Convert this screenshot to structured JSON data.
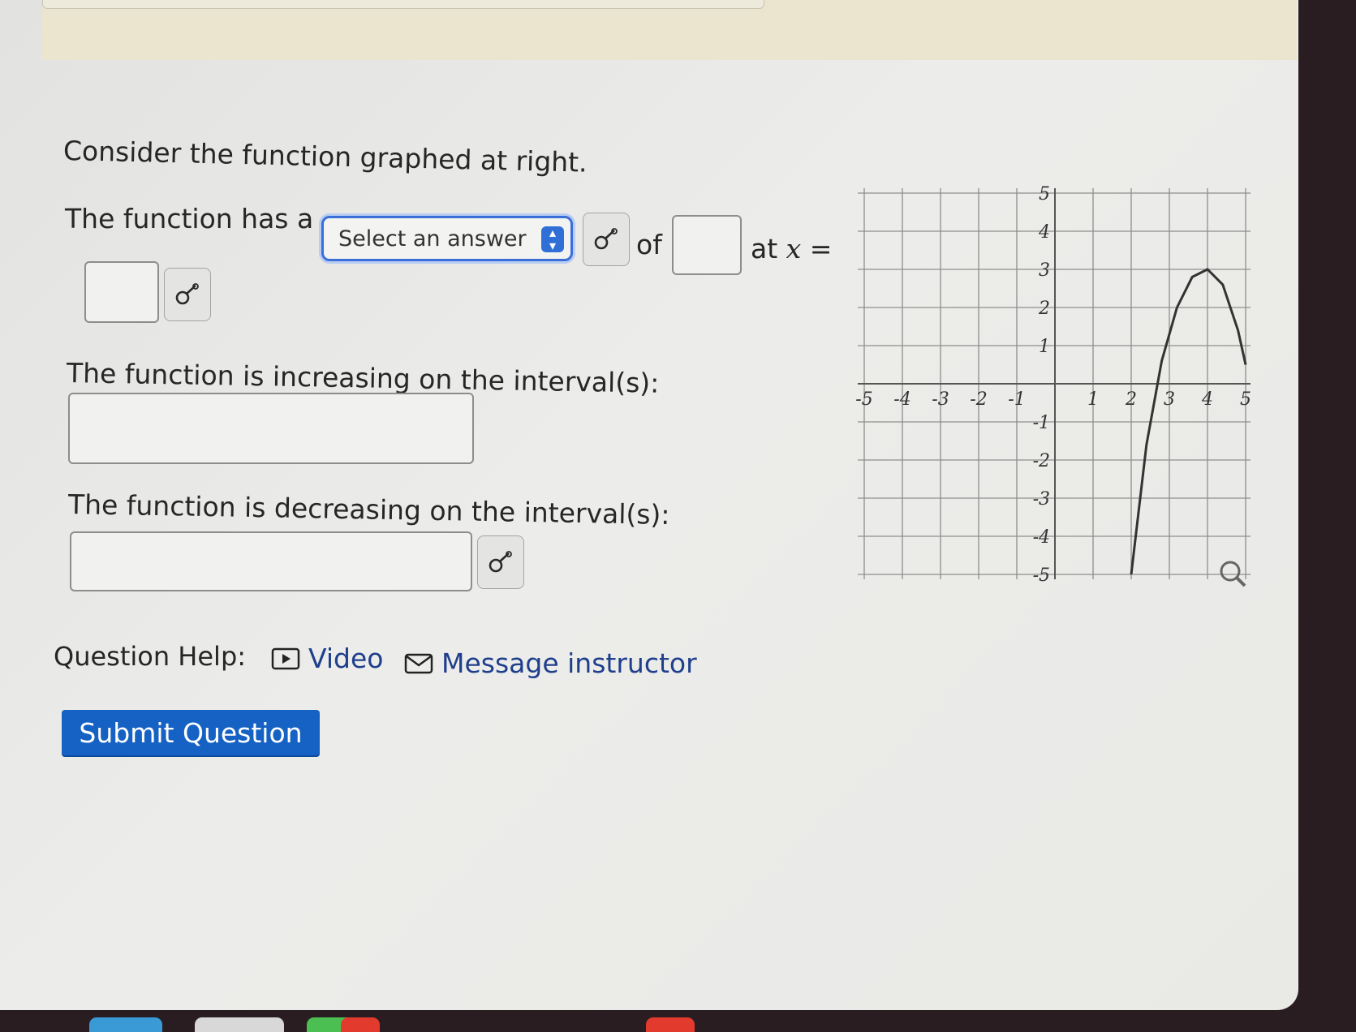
{
  "question": {
    "intro": "Consider the function graphed at right.",
    "q1_prefix": "The function has a",
    "select_placeholder": "Select an answer",
    "q1_of": "of",
    "q1_at": "at",
    "q1_var": "x",
    "q1_eq": "=",
    "q2": "The function is increasing on the interval(s):",
    "q3": "The function is decreasing on the interval(s):"
  },
  "help": {
    "label": "Question Help:",
    "video": "Video",
    "message": "Message instructor"
  },
  "submit_label": "Submit Question",
  "colors": {
    "accent": "#1562c4",
    "select_border": "#3b6fd8",
    "link": "#1f3f8c"
  },
  "icons": {
    "preview": "preview-icon",
    "video": "play-icon",
    "message": "envelope-icon",
    "zoom": "magnifier-icon"
  },
  "chart_data": {
    "type": "line",
    "x_ticks": [
      "-5",
      "-4",
      "-3",
      "-2",
      "-1",
      "1",
      "2",
      "3",
      "4",
      "5"
    ],
    "y_ticks": [
      "5",
      "4",
      "3",
      "2",
      "1",
      "-1",
      "-2",
      "-3",
      "-4",
      "-5"
    ],
    "xlim": [
      -5,
      5
    ],
    "ylim": [
      -5,
      5
    ],
    "grid": true,
    "series": [
      {
        "x": [
          2.0,
          2.4,
          2.8,
          3.2,
          3.6,
          4.0,
          4.4,
          4.8,
          5.0
        ],
        "y": [
          -5.0,
          -1.6,
          0.6,
          2.0,
          2.8,
          3.0,
          2.6,
          1.4,
          0.5
        ]
      }
    ]
  }
}
